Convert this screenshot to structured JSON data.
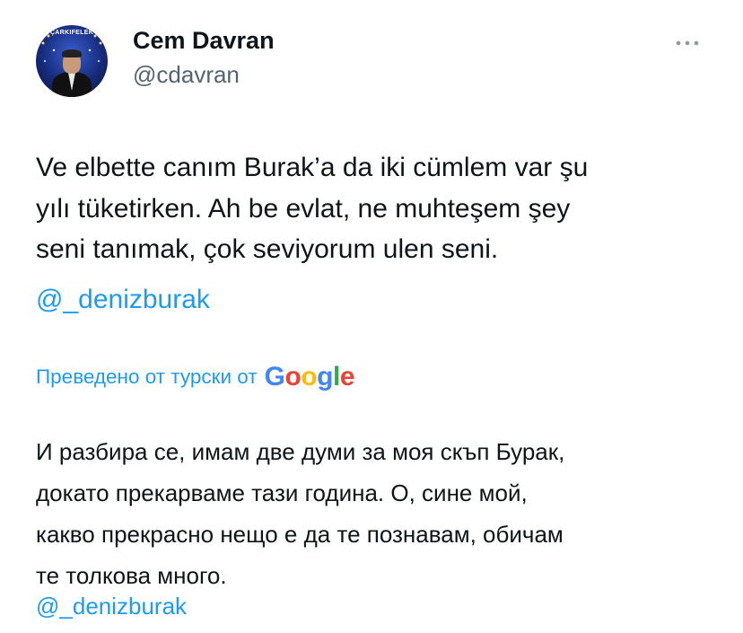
{
  "author": {
    "name": "Cem Davran",
    "handle": "@cdavran",
    "avatar_logo_text": "ÇARKIFELEK"
  },
  "more_icon": "more-horizontal-icon",
  "tweet": {
    "text": "Ve elbette canım Burak’a da iki cümlem var şu\nyılı tüketirken. Ah be evlat, ne muhteşem şey\nseni tanımak, çok seviyorum ulen seni.",
    "mention": "@_denizburak"
  },
  "translation": {
    "label": "Преведено от турски от",
    "provider": [
      "G",
      "o",
      "o",
      "g",
      "l",
      "e"
    ],
    "provider_colors": [
      "#4285F4",
      "#EA4335",
      "#FBBC05",
      "#4285F4",
      "#34A853",
      "#EA4335"
    ],
    "text": "И разбира се, имам две думи за моя скъп Бурак,\nдокато прекарваме тази година. О, сине мой,\nкакво прекрасно нещо е да те познавам, обичам\nте толкова много.",
    "mention": "@_denizburak"
  },
  "colors": {
    "link": "#1d9bf0",
    "text": "#0f1419",
    "secondary": "#536471"
  }
}
